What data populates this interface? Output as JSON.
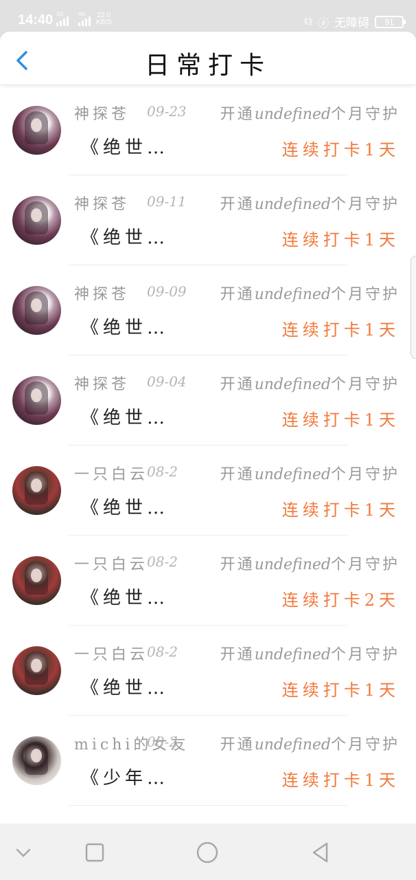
{
  "status_bar": {
    "time": "14:40",
    "network_1": "3G",
    "network_2": "4G",
    "speed_value": "22.0",
    "speed_unit": "KB/S",
    "accessibility_text": "无障碍",
    "battery_level": "91"
  },
  "header": {
    "title": "日常打卡"
  },
  "entries": [
    {
      "name": "神探苍",
      "date": "09-23",
      "action_prefix": "开通",
      "action_mid": "undefined",
      "action_suffix": "个月守护",
      "book": "《绝世…",
      "streak": "连续打卡1天",
      "avatar": "style-a"
    },
    {
      "name": "神探苍",
      "date": "09-11",
      "action_prefix": "开通",
      "action_mid": "undefined",
      "action_suffix": "个月守护",
      "book": "《绝世…",
      "streak": "连续打卡1天",
      "avatar": "style-a"
    },
    {
      "name": "神探苍",
      "date": "09-09",
      "action_prefix": "开通",
      "action_mid": "undefined",
      "action_suffix": "个月守护",
      "book": "《绝世…",
      "streak": "连续打卡1天",
      "avatar": "style-a"
    },
    {
      "name": "神探苍",
      "date": "09-04",
      "action_prefix": "开通",
      "action_mid": "undefined",
      "action_suffix": "个月守护",
      "book": "《绝世…",
      "streak": "连续打卡1天",
      "avatar": "style-a"
    },
    {
      "name": "一只白云",
      "date": "08-2",
      "action_prefix": "开通",
      "action_mid": "undefined",
      "action_suffix": "个月守护",
      "book": "《绝世…",
      "streak": "连续打卡1天",
      "avatar": "style-b"
    },
    {
      "name": "一只白云",
      "date": "08-2",
      "action_prefix": "开通",
      "action_mid": "undefined",
      "action_suffix": "个月守护",
      "book": "《绝世…",
      "streak": "连续打卡2天",
      "avatar": "style-b"
    },
    {
      "name": "一只白云",
      "date": "08-2",
      "action_prefix": "开通",
      "action_mid": "undefined",
      "action_suffix": "个月守护",
      "book": "《绝世…",
      "streak": "连续打卡1天",
      "avatar": "style-b"
    },
    {
      "name": "michi的女友",
      "date": "08-2",
      "action_prefix": "开通",
      "action_mid": "undefined",
      "action_suffix": "个月守护",
      "book": "《少年…",
      "streak": "连续打卡1天",
      "avatar": "style-c"
    }
  ],
  "colors": {
    "accent_orange": "#f07a3c",
    "back_blue": "#2f8fe0",
    "muted_text": "#9a9a9a"
  },
  "icons": {
    "back": "chevron-left-icon",
    "nav_back": "chevron-down-icon",
    "nav_recents": "square-icon",
    "nav_home": "circle-icon",
    "nav_triangle": "triangle-left-icon"
  }
}
